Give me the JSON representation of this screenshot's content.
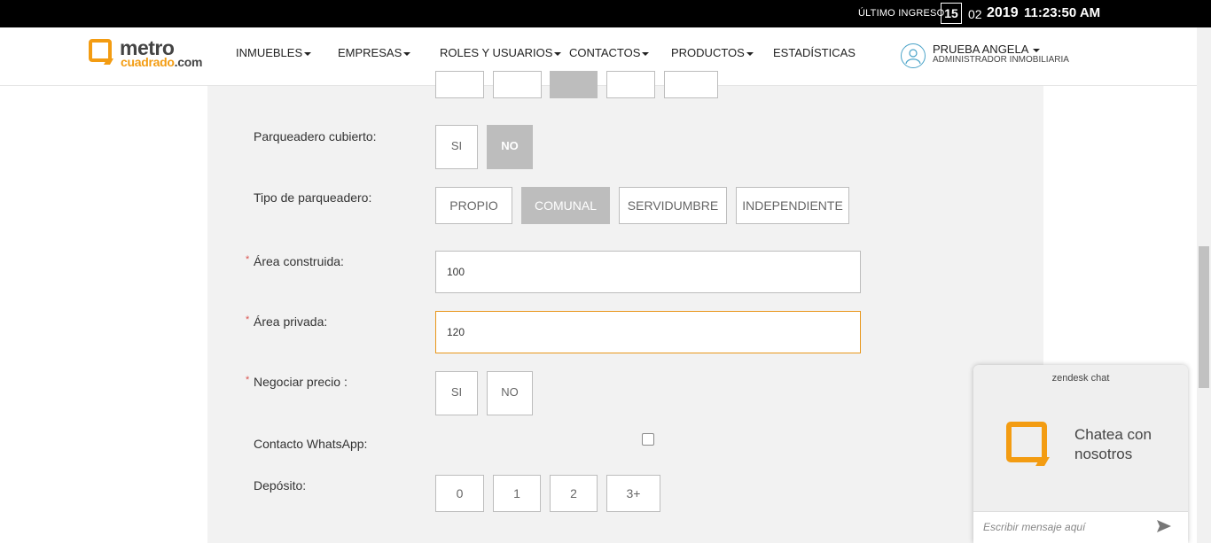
{
  "topbar": {
    "last_login_label": "ÚLTIMO INGRESO",
    "day": "15",
    "month": "02",
    "year": "2019",
    "time": "11:23:50 AM"
  },
  "logo": {
    "line1": "metro",
    "line2": "cuadrado",
    "line2_suffix": ".com",
    "accent": "#f39c12"
  },
  "nav": [
    {
      "label": "INMUEBLES"
    },
    {
      "label": "EMPRESAS"
    },
    {
      "label": "ROLES Y USUARIOS"
    },
    {
      "label": "CONTACTOS"
    },
    {
      "label": "PRODUCTOS"
    },
    {
      "label": "ESTADÍSTICAS"
    }
  ],
  "user": {
    "name": "PRUEBA ANGELA",
    "role": "ADMINISTRADOR INMOBILIARIA"
  },
  "form": {
    "parking_covered": {
      "label": "Parqueadero cubierto:",
      "options": [
        "SI",
        "NO"
      ],
      "selected": "NO"
    },
    "parking_type": {
      "label": "Tipo de parqueadero:",
      "options": [
        "PROPIO",
        "COMUNAL",
        "SERVIDUMBRE",
        "INDEPENDIENTE"
      ],
      "selected": "COMUNAL"
    },
    "built_area": {
      "label": "Área construida:",
      "required": "*",
      "value": "100"
    },
    "private_area": {
      "label": "Área privada:",
      "required": "*",
      "value": "120"
    },
    "negotiate": {
      "label": "Negociar precio :",
      "required": "*",
      "options": [
        "SI",
        "NO"
      ]
    },
    "whatsapp": {
      "label": "Contacto WhatsApp:",
      "checked": false
    },
    "deposit": {
      "label": "Depósito:",
      "options": [
        "0",
        "1",
        "2",
        "3+"
      ]
    }
  },
  "chat": {
    "brand": "zendesk chat",
    "title": "Chatea con nosotros",
    "placeholder": "Escribir mensaje aquí",
    "send_icon": "send-icon"
  },
  "colors": {
    "accent_orange": "#f39c12",
    "selected_gray": "#bdbdbd",
    "focus_border": "#e8961a"
  }
}
